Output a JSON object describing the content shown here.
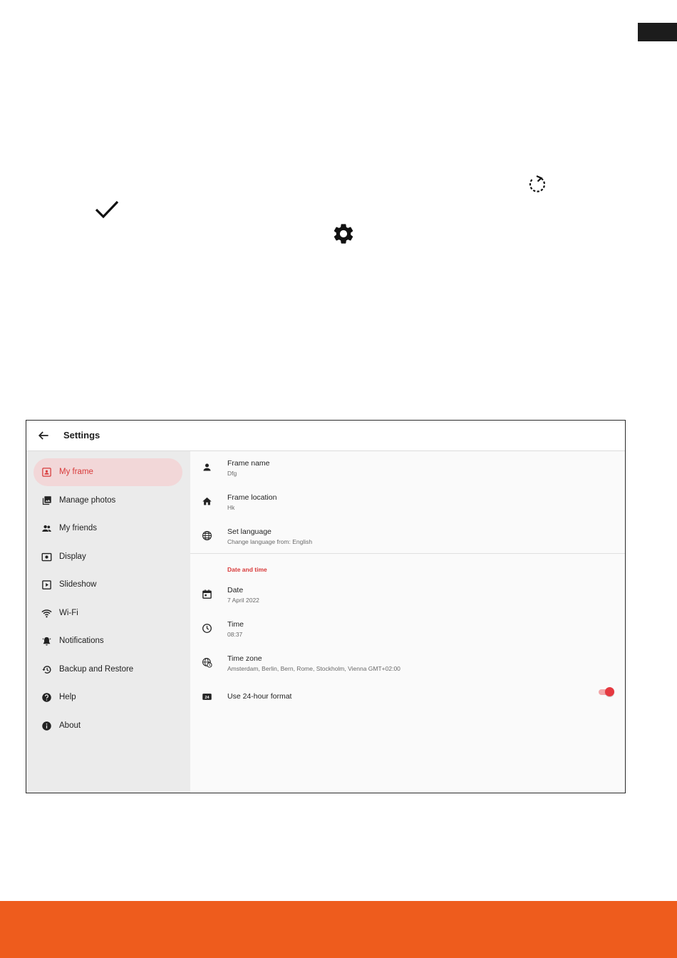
{
  "app": {
    "title": "Settings"
  },
  "sidebar": {
    "items": [
      {
        "label": "My frame",
        "icon": "contact-card-icon",
        "active": true
      },
      {
        "label": "Manage photos",
        "icon": "photo-library-icon"
      },
      {
        "label": "My friends",
        "icon": "people-icon"
      },
      {
        "label": "Display",
        "icon": "display-brightness-icon"
      },
      {
        "label": "Slideshow",
        "icon": "slideshow-icon"
      },
      {
        "label": "Wi-Fi",
        "icon": "wifi-icon"
      },
      {
        "label": "Notifications",
        "icon": "bell-icon"
      },
      {
        "label": "Backup and Restore",
        "icon": "restore-icon"
      },
      {
        "label": "Help",
        "icon": "help-icon"
      },
      {
        "label": "About",
        "icon": "info-icon"
      }
    ]
  },
  "content": {
    "rows": [
      {
        "title": "Frame name",
        "subtitle": "Dfg",
        "icon": "person-icon"
      },
      {
        "title": "Frame location",
        "subtitle": "Hk",
        "icon": "home-icon"
      },
      {
        "title": "Set language",
        "subtitle": "Change language from: English",
        "icon": "globe-icon"
      }
    ],
    "date_section": {
      "header": "Date and time",
      "rows": [
        {
          "title": "Date",
          "subtitle": "7 April 2022",
          "icon": "calendar-icon"
        },
        {
          "title": "Time",
          "subtitle": "08:37",
          "icon": "clock-icon"
        },
        {
          "title": "Time zone",
          "subtitle": "Amsterdam, Berlin, Bern, Rome, Stockholm, Vienna GMT+02:00",
          "icon": "globe-clock-icon"
        }
      ],
      "toggle": {
        "label": "Use 24-hour format",
        "icon": "24h-icon",
        "on": true
      }
    }
  },
  "colors": {
    "accent": "#e53940",
    "active_bg": "#f2d7d8",
    "orange": "#ee5c1d"
  }
}
